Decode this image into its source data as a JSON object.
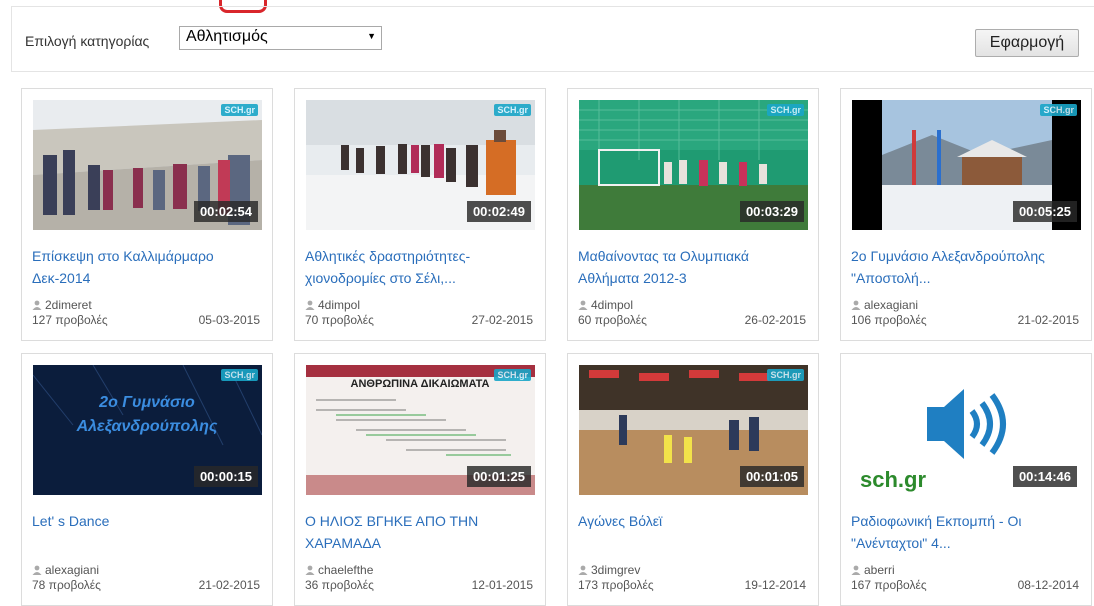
{
  "filter": {
    "label": "Επιλογή κατηγορίας",
    "selected_category": "Αθλητισμός",
    "apply_label": "Εφαρμογή"
  },
  "brand": {
    "badge": "SCH.gr",
    "logo_text": "sch.gr"
  },
  "videos": [
    {
      "title": "Επίσκεψη στο Καλλιμάρμαρο Δεκ-2014",
      "duration": "00:02:54",
      "author": "2dimeret",
      "views": "127 προβολές",
      "date": "05-03-2015",
      "thumb": "stadium"
    },
    {
      "title": "Αθλητικές δραστηριότητες-χιονοδρομίες στο Σέλι,...",
      "duration": "00:02:49",
      "author": "4dimpol",
      "views": "70 προβολές",
      "date": "27-02-2015",
      "thumb": "snow"
    },
    {
      "title": "Μαθαίνοντας τα Ολυμπιακά Αθλήματα 2012-3",
      "duration": "00:03:29",
      "author": "4dimpol",
      "views": "60 προβολές",
      "date": "26-02-2015",
      "thumb": "field"
    },
    {
      "title": "2ο Γυμνάσιο Αλεξανδρούπολης \"Αποστολή...",
      "duration": "00:05:25",
      "author": "alexagiani",
      "views": "106 προβολές",
      "date": "21-02-2015",
      "thumb": "ski"
    },
    {
      "title": "Let' s Dance",
      "duration": "00:00:15",
      "author": "alexagiani",
      "views": "78 προβολές",
      "date": "21-02-2015",
      "thumb": "dance",
      "thumb_text": [
        "2ο Γυμνάσιο",
        "Αλεξανδρούπολης"
      ]
    },
    {
      "title": "Ο ΗΛΙΟΣ ΒΓΗΚΕ ΑΠΟ ΤΗΝ ΧΑΡΑΜΑΔΑ",
      "duration": "00:01:25",
      "author": "chaelefthe",
      "views": "36 προβολές",
      "date": "12-01-2015",
      "thumb": "rights",
      "thumb_text": [
        "ΑΝΘΡΩΠΙΝΑ ΔΙΚΑΙΩΜΑΤΑ"
      ]
    },
    {
      "title": "Αγώνες Βόλεϊ",
      "duration": "00:01:05",
      "author": "3dimgrev",
      "views": "173 προβολές",
      "date": "19-12-2014",
      "thumb": "gym"
    },
    {
      "title": "Ραδιοφωνική Εκπομπή - Οι \"Ανένταχτοι\" 4...",
      "duration": "00:14:46",
      "author": "aberri",
      "views": "167 προβολές",
      "date": "08-12-2014",
      "thumb": "audio"
    }
  ]
}
